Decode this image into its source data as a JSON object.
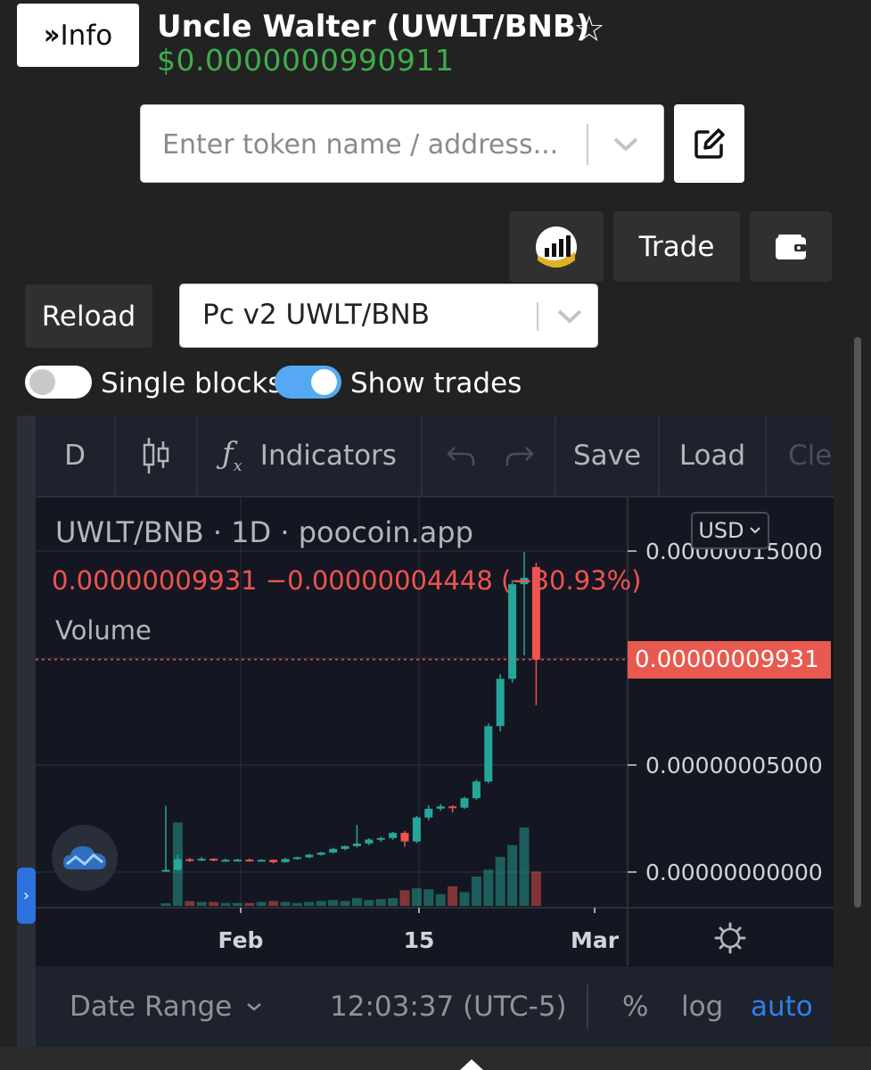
{
  "header": {
    "info_label": "Info",
    "title": "Uncle Walter (UWLT/BNB)",
    "price": "$0.0000000990911"
  },
  "search": {
    "placeholder": "Enter token name / address..."
  },
  "actions": {
    "trade_label": "Trade",
    "reload_label": "Reload"
  },
  "pair_select": {
    "value": "Pc v2 UWLT/BNB"
  },
  "toggles": {
    "single_blocks": {
      "label": "Single blocks",
      "on": false
    },
    "show_trades": {
      "label": "Show trades",
      "on": true
    }
  },
  "chart_toolbar": {
    "interval": "D",
    "indicators_label": "Indicators",
    "save_label": "Save",
    "load_label": "Load",
    "clear_label_partial": "Cle"
  },
  "chart_legend": {
    "symbol_line": "UWLT/BNB · 1D · poocoin.app",
    "ohlc_line": "0.00000009931 −0.00000004448 (−30.93%)",
    "volume_label": "Volume",
    "currency": "USD"
  },
  "chart_data": {
    "type": "candlestick",
    "symbol": "UWLT/BNB",
    "interval": "1D",
    "currency": "USD",
    "last_price_label": "0.00000009931",
    "y_tick_labels": [
      "0.00000015000",
      "0.00000005000",
      "0.00000000000"
    ],
    "y_ticks": [
      1.5e-07,
      5e-08,
      0.0
    ],
    "x_tick_labels": [
      "Feb",
      "15",
      "Mar"
    ],
    "ylim": [
      -5e-09,
      1.6e-07
    ],
    "grid": true,
    "colors": {
      "up": "#26a69a",
      "down": "#ef5350",
      "background": "#141721"
    },
    "candles": [
      {
        "o": 5e-10,
        "h": 3.1e-08,
        "l": 5e-10,
        "c": 1e-09,
        "v": 0.0
      },
      {
        "o": 1e-09,
        "h": 8e-09,
        "l": 5e-10,
        "c": 6e-09,
        "v": 0.85
      },
      {
        "o": 6e-09,
        "h": 6.6e-09,
        "l": 4.8e-09,
        "c": 5.5e-09,
        "v": 0.05
      },
      {
        "o": 5.5e-09,
        "h": 7e-09,
        "l": 5.2e-09,
        "c": 6.2e-09,
        "v": 0.04
      },
      {
        "o": 6.2e-09,
        "h": 6.4e-09,
        "l": 5e-09,
        "c": 5.4e-09,
        "v": 0.04
      },
      {
        "o": 5.4e-09,
        "h": 6.3e-09,
        "l": 5.1e-09,
        "c": 5.7e-09,
        "v": 0.03
      },
      {
        "o": 5.7e-09,
        "h": 6.2e-09,
        "l": 5.2e-09,
        "c": 5.8e-09,
        "v": 0.03
      },
      {
        "o": 5.8e-09,
        "h": 6.3e-09,
        "l": 5e-09,
        "c": 5.3e-09,
        "v": 0.03
      },
      {
        "o": 5.3e-09,
        "h": 6e-09,
        "l": 4.9e-09,
        "c": 5.7e-09,
        "v": 0.04
      },
      {
        "o": 5.7e-09,
        "h": 5.9e-09,
        "l": 4e-09,
        "c": 4.6e-09,
        "v": 0.05
      },
      {
        "o": 4.6e-09,
        "h": 6.6e-09,
        "l": 4.3e-09,
        "c": 6.1e-09,
        "v": 0.04
      },
      {
        "o": 6.1e-09,
        "h": 7.2e-09,
        "l": 5.8e-09,
        "c": 6.9e-09,
        "v": 0.03
      },
      {
        "o": 6.9e-09,
        "h": 8.4e-09,
        "l": 6.6e-09,
        "c": 8.1e-09,
        "v": 0.04
      },
      {
        "o": 8.1e-09,
        "h": 9.4e-09,
        "l": 7.7e-09,
        "c": 9.1e-09,
        "v": 0.05
      },
      {
        "o": 9.1e-09,
        "h": 1.14e-08,
        "l": 8.8e-09,
        "c": 1.08e-08,
        "v": 0.06
      },
      {
        "o": 1.08e-08,
        "h": 1.24e-08,
        "l": 1.02e-08,
        "c": 1.21e-08,
        "v": 0.05
      },
      {
        "o": 1.21e-08,
        "h": 2.2e-08,
        "l": 1.15e-08,
        "c": 1.33e-08,
        "v": 0.08
      },
      {
        "o": 1.33e-08,
        "h": 1.58e-08,
        "l": 1.26e-08,
        "c": 1.52e-08,
        "v": 0.06
      },
      {
        "o": 1.52e-08,
        "h": 1.65e-08,
        "l": 1.42e-08,
        "c": 1.59e-08,
        "v": 0.07
      },
      {
        "o": 1.59e-08,
        "h": 1.88e-08,
        "l": 1.51e-08,
        "c": 1.83e-08,
        "v": 0.08
      },
      {
        "o": 1.83e-08,
        "h": 1.92e-08,
        "l": 1.18e-08,
        "c": 1.43e-08,
        "v": 0.16
      },
      {
        "o": 1.43e-08,
        "h": 2.62e-08,
        "l": 1.35e-08,
        "c": 2.55e-08,
        "v": 0.18
      },
      {
        "o": 2.55e-08,
        "h": 3.12e-08,
        "l": 2.42e-08,
        "c": 2.96e-08,
        "v": 0.17
      },
      {
        "o": 2.96e-08,
        "h": 3.18e-08,
        "l": 2.86e-08,
        "c": 3.07e-08,
        "v": 0.12
      },
      {
        "o": 3.07e-08,
        "h": 3.12e-08,
        "l": 2.78e-08,
        "c": 3.01e-08,
        "v": 0.2
      },
      {
        "o": 3.01e-08,
        "h": 3.52e-08,
        "l": 2.95e-08,
        "c": 3.45e-08,
        "v": 0.14
      },
      {
        "o": 3.45e-08,
        "h": 4.32e-08,
        "l": 3.38e-08,
        "c": 4.23e-08,
        "v": 0.3
      },
      {
        "o": 4.23e-08,
        "h": 6.95e-08,
        "l": 4.15e-08,
        "c": 6.82e-08,
        "v": 0.37
      },
      {
        "o": 6.82e-08,
        "h": 9.25e-08,
        "l": 6.58e-08,
        "c": 9.03e-08,
        "v": 0.5
      },
      {
        "o": 9.03e-08,
        "h": 1.365e-07,
        "l": 8.85e-08,
        "c": 1.345e-07,
        "v": 0.62
      },
      {
        "o": 1.345e-07,
        "h": 1.495e-07,
        "l": 1.012e-07,
        "c": 1.375e-07,
        "v": 0.8
      },
      {
        "o": 1.425e-07,
        "h": 1.445e-07,
        "l": 7.8e-08,
        "c": 9.93e-08,
        "v": 0.35
      }
    ]
  },
  "chart_bottom": {
    "date_range_label": "Date Range",
    "time": "12:03:37 (UTC-5)",
    "percent": "%",
    "log": "log",
    "auto": "auto"
  }
}
